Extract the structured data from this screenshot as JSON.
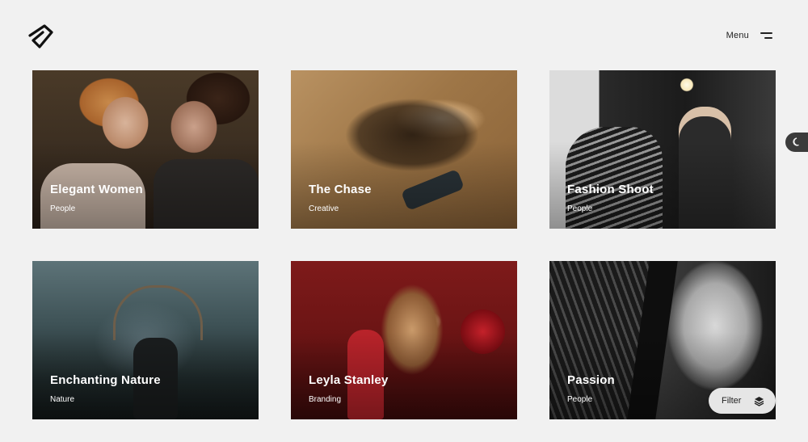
{
  "header": {
    "menu_label": "Menu"
  },
  "portfolio": {
    "items": [
      {
        "title": "Elegant Women",
        "category": "People"
      },
      {
        "title": "The Chase",
        "category": "Creative"
      },
      {
        "title": "Fashion Shoot",
        "category": "People"
      },
      {
        "title": "Enchanting Nature",
        "category": "Nature"
      },
      {
        "title": "Leyla Stanley",
        "category": "Branding"
      },
      {
        "title": "Passion",
        "category": "People"
      }
    ]
  },
  "filter": {
    "label": "Filter"
  },
  "icons": {
    "logo": "brand-logo-icon",
    "menu": "hamburger-menu-icon",
    "theme": "moon-icon",
    "filter": "layers-icon"
  }
}
